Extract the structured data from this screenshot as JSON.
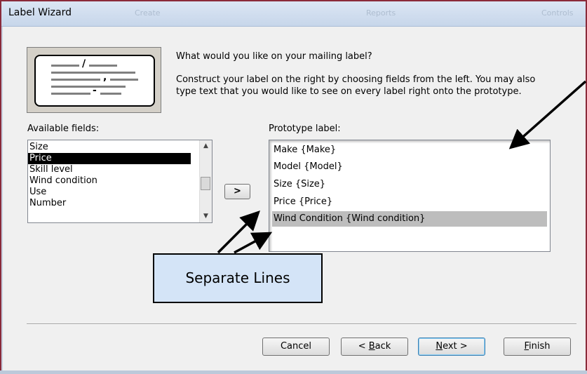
{
  "window": {
    "title": "Label Wizard",
    "ghost_tabs": [
      "Create",
      "Reports",
      "Controls"
    ]
  },
  "preview": {
    "glyphs": [
      "/",
      ",",
      "-"
    ]
  },
  "instructions": {
    "question": "What would you like on your mailing label?",
    "line1": "Construct your label on the right by choosing fields from the left. You may also",
    "line2": "type text that you would like to see on every label right onto the prototype."
  },
  "available_fields": {
    "label": "Available fields:",
    "items": [
      "Size",
      "Price",
      "Skill level",
      "Wind condition",
      "Use",
      "Number"
    ],
    "selected": "Price"
  },
  "add_button": {
    "label": ">"
  },
  "prototype": {
    "label": "Prototype label:",
    "lines": [
      "Make {Make}",
      "Model {Model}",
      "Size {Size}",
      "Price {Price}",
      "Wind Condition {Wind condition}"
    ],
    "highlighted": "Wind Condition {Wind condition}"
  },
  "callout": {
    "text": "Separate Lines"
  },
  "buttons": {
    "cancel": "Cancel",
    "back_prefix": "< ",
    "back_accel": "B",
    "back_rest": "ack",
    "next_accel": "N",
    "next_rest": "ext >",
    "finish_accel": "F",
    "finish_rest": "inish"
  },
  "colors": {
    "frame_border": "#8a2a3a",
    "callout_fill": "#d4e4f7",
    "selection": "#000000",
    "highlight_row": "#bdbdbd"
  }
}
